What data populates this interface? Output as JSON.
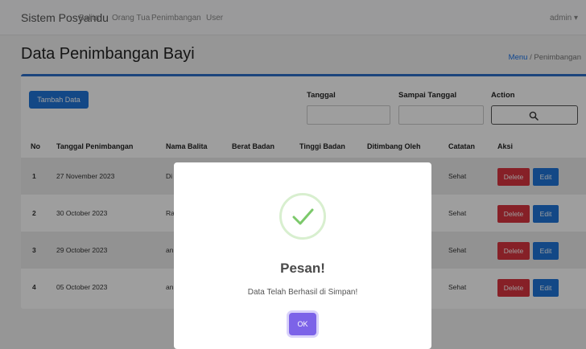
{
  "navbar": {
    "brand": "Sistem Posyandu",
    "links": [
      "Balita",
      "Orang Tua",
      "Penimbangan",
      "User"
    ],
    "user": "admin ▾"
  },
  "page": {
    "title": "Data Penimbangan Bayi",
    "breadcrumb_link": "Menu",
    "breadcrumb_sep": " / ",
    "breadcrumb_current": "Penimbangan"
  },
  "toolbar": {
    "add_label": "Tambah Data",
    "date_label": "Tanggal",
    "until_label": "Sampai Tanggal",
    "action_label": "Action"
  },
  "table": {
    "headers": [
      "No",
      "Tanggal Penimbangan",
      "Nama Balita",
      "Berat Badan",
      "Tinggi Badan",
      "Ditimbang Oleh",
      "Catatan",
      "Aksi"
    ],
    "rows": [
      {
        "no": "1",
        "tanggal": "27 November 2023",
        "nama": "Di",
        "catatan": "Sehat"
      },
      {
        "no": "2",
        "tanggal": "30 October 2023",
        "nama": "Ra",
        "catatan": "Sehat"
      },
      {
        "no": "3",
        "tanggal": "29 October 2023",
        "nama": "an",
        "catatan": "Sehat"
      },
      {
        "no": "4",
        "tanggal": "05 October 2023",
        "nama": "an",
        "catatan": "Sehat"
      }
    ],
    "delete_label": "Delete",
    "edit_label": "Edit"
  },
  "modal": {
    "title": "Pesan!",
    "message": "Data Telah Berhasil di Simpan!",
    "ok_label": "OK",
    "icon": "checkmark-success-icon"
  },
  "colors": {
    "primary": "#1f75d8",
    "danger": "#d9343f",
    "success": "#7cc96b",
    "modal_button": "#7c63e8"
  }
}
